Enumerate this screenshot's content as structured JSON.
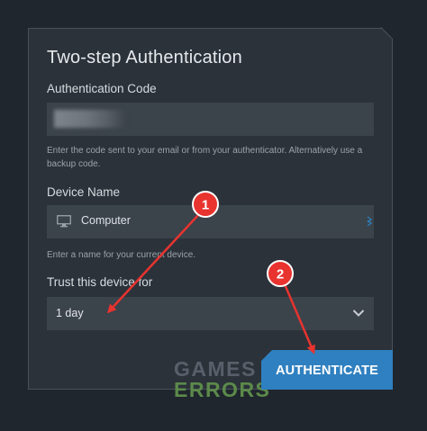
{
  "dialog": {
    "title": "Two-step Authentication",
    "auth_code": {
      "label": "Authentication Code",
      "hint": "Enter the code sent to your email or from your authenticator. Alternatively use a backup code."
    },
    "device_name": {
      "label": "Device Name",
      "value": "Computer",
      "icon": "monitor-icon",
      "hint": "Enter a name for your current device."
    },
    "trust": {
      "label": "Trust this device for",
      "selected": "1 day",
      "icon": "chevron-down-icon"
    },
    "authenticate_button": "AUTHENTICATE"
  },
  "annotations": {
    "step1": "1",
    "step2": "2",
    "badge_color": "#e8332f",
    "arrow_color": "#e8332f"
  },
  "watermark": {
    "line1": "GAMES",
    "line2": "ERRORS"
  },
  "colors": {
    "background": "#20262d",
    "panel": "#2b323a",
    "field": "#3b434b",
    "accent": "#2f80c0"
  }
}
